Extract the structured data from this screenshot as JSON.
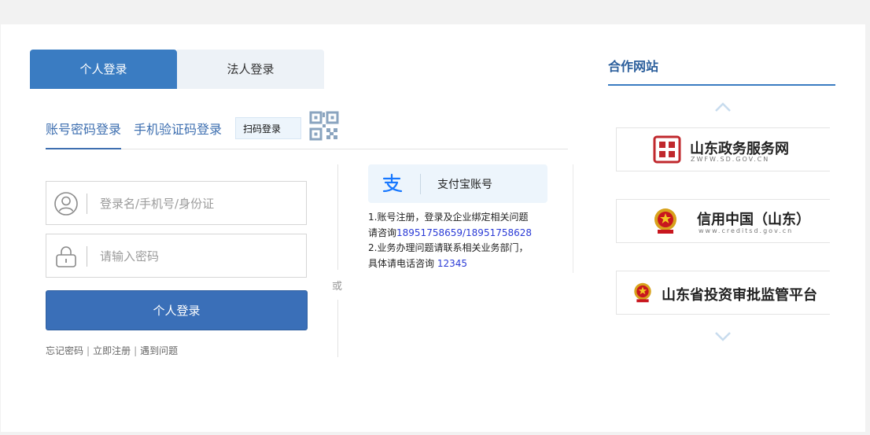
{
  "login_type_tabs": [
    {
      "label": "个人登录",
      "active": true
    },
    {
      "label": "法人登录",
      "active": false
    }
  ],
  "method_tabs": {
    "account_password": "账号密码登录",
    "sms_code": "手机验证码登录",
    "scan": "扫码登录"
  },
  "form": {
    "username_placeholder": "登录名/手机号/身份证",
    "password_placeholder": "请输入密码",
    "submit_label": "个人登录"
  },
  "links": {
    "forgot": "忘记密码",
    "register": "立即注册",
    "problem": "遇到问题",
    "separator": "|"
  },
  "or_label": "或",
  "alipay": {
    "label": "支付宝账号",
    "icon": "alipay-icon"
  },
  "notes": {
    "line1": "1.账号注册，登录及企业绑定相关问题",
    "line2_prefix": "请咨询",
    "line2_phones": "18951758659/18951758628",
    "line3": "2.业务办理问题请联系相关业务部门，",
    "line4_prefix": "具体请电话咨询 ",
    "line4_phone": "12345"
  },
  "partner": {
    "title": "合作网站",
    "sites": [
      {
        "name": "山东政务服务网",
        "sub": "ZWFW.SD.GOV.CN"
      },
      {
        "name": "信用中国（山东）",
        "sub": "www.creditsd.gov.cn"
      },
      {
        "name": "山东省投资审批监管平台"
      }
    ]
  },
  "colors": {
    "primary": "#3a7cc2",
    "button": "#3a6fb8",
    "link_blue": "#2a3ad6",
    "tab_light": "#edf2f7"
  }
}
